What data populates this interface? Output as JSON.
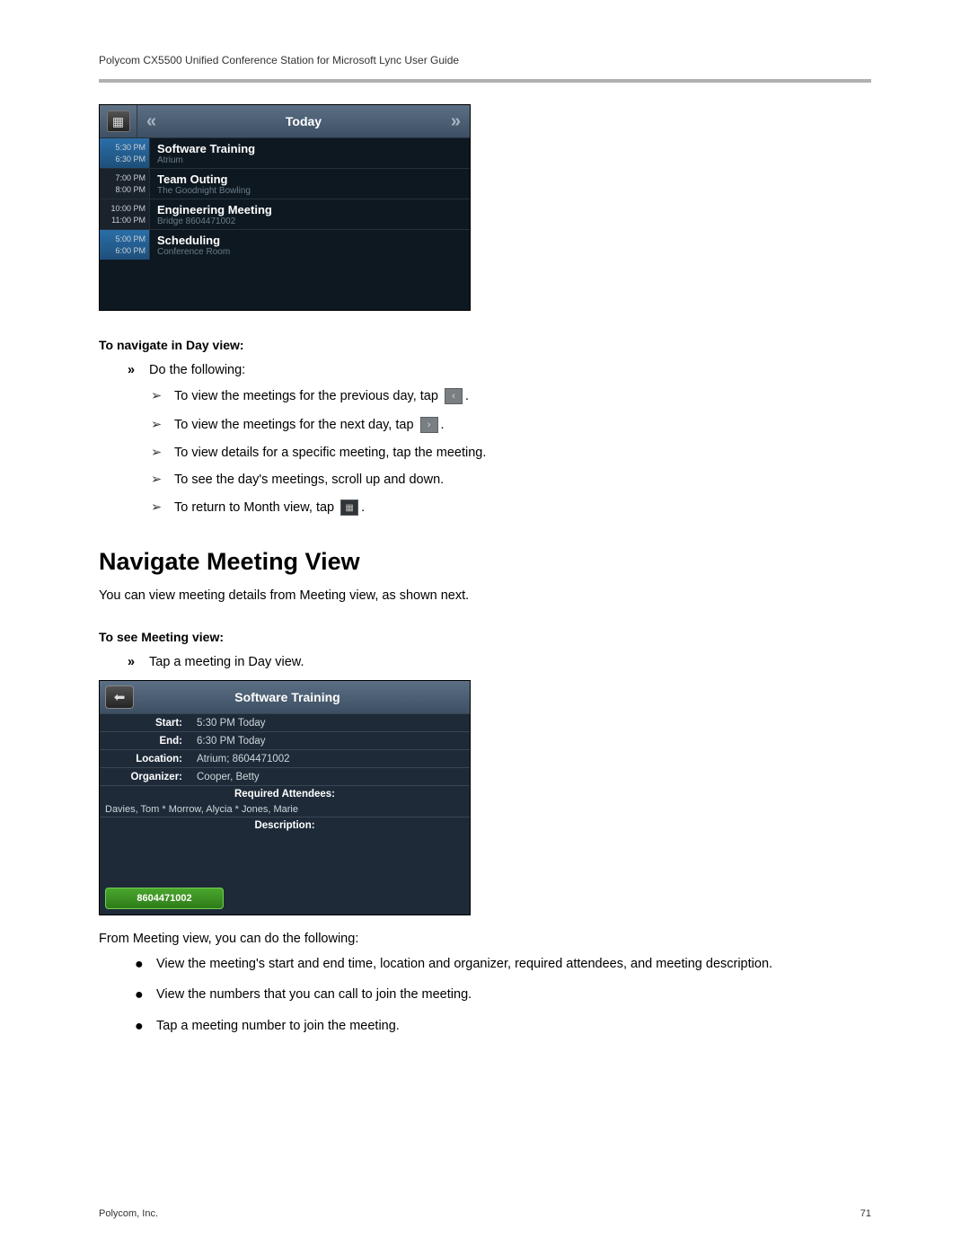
{
  "header": "Polycom CX5500 Unified Conference Station for Microsoft Lync User Guide",
  "day_view": {
    "title": "Today",
    "events": [
      {
        "start": "5:30 PM",
        "end": "6:30 PM",
        "title": "Software Training",
        "location": "Atrium",
        "selected": true
      },
      {
        "start": "7:00 PM",
        "end": "8:00 PM",
        "title": "Team Outing",
        "location": "The Goodnight Bowling",
        "selected": false
      },
      {
        "start": "10:00 PM",
        "end": "11:00 PM",
        "title": "Engineering Meeting",
        "location": "Bridge 8604471002",
        "selected": false
      },
      {
        "start": "5:00 PM",
        "end": "6:00 PM",
        "title": "Scheduling",
        "location": "Conference Room",
        "selected": true
      }
    ]
  },
  "nav_section": {
    "title": "To navigate in Day view:",
    "first": "Do the following:",
    "items": [
      {
        "pre": "To view the meetings for the previous day, tap ",
        "icon": "prev",
        "post": "."
      },
      {
        "pre": "To view the meetings for the next day, tap ",
        "icon": "next",
        "post": "."
      },
      {
        "pre": "To view details for a specific meeting, tap the meeting.",
        "icon": "",
        "post": ""
      },
      {
        "pre": "To see the day's meetings, scroll up and down.",
        "icon": "",
        "post": ""
      },
      {
        "pre": "To return to Month view, tap ",
        "icon": "cal",
        "post": "."
      }
    ]
  },
  "heading": "Navigate Meeting View",
  "intro": "You can view meeting details from Meeting view, as shown next.",
  "see_section": {
    "title": "To see Meeting view:",
    "item": "Tap a meeting in Day view."
  },
  "meeting_view": {
    "title": "Software Training",
    "rows": {
      "start_label": "Start:",
      "start_value": "5:30 PM Today",
      "end_label": "End:",
      "end_value": "6:30 PM Today",
      "location_label": "Location:",
      "location_value": "Atrium; 8604471002",
      "organizer_label": "Organizer:",
      "organizer_value": "Cooper, Betty"
    },
    "required_label": "Required Attendees:",
    "attendees": "Davies, Tom * Morrow, Alycia * Jones, Marie",
    "description_label": "Description:",
    "dial_number": "8604471002"
  },
  "after_meeting": "From Meeting view, you can do the following:",
  "bullets": [
    "View the meeting's start and end time, location and organizer, required attendees, and meeting description.",
    "View the numbers that you can call to join the meeting.",
    "Tap a meeting number to join the meeting."
  ],
  "footer": {
    "left": "Polycom, Inc.",
    "right": "71"
  }
}
